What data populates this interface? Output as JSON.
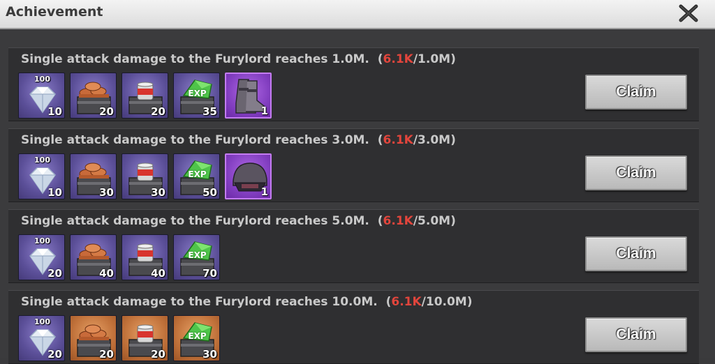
{
  "header": {
    "title": "Achievement",
    "close_icon": "close-icon"
  },
  "colors": {
    "progress_current": "#e2453c",
    "header_bg": "#e8e8e8",
    "row_bg": "#2f2f31"
  },
  "rows": [
    {
      "task": "Single attack damage to the Furylord reaches 1.0M.",
      "progress_open": "(",
      "progress_current": "6.1K",
      "progress_total": "/1.0M)",
      "claim_label": "Claim",
      "rewards": [
        {
          "icon": "diamond-icon",
          "badge": "100",
          "qty": "10",
          "frame": "purple"
        },
        {
          "icon": "wood-chest-icon",
          "qty": "20",
          "frame": "purple"
        },
        {
          "icon": "food-chest-icon",
          "qty": "20",
          "frame": "purple"
        },
        {
          "icon": "exp-chest-icon",
          "badge": "EXP",
          "qty": "35",
          "frame": "purple"
        },
        {
          "icon": "boots-icon",
          "qty": "1",
          "frame": "epic"
        }
      ]
    },
    {
      "task": "Single attack damage to the Furylord reaches 3.0M.",
      "progress_open": "(",
      "progress_current": "6.1K",
      "progress_total": "/3.0M)",
      "claim_label": "Claim",
      "rewards": [
        {
          "icon": "diamond-icon",
          "badge": "100",
          "qty": "10",
          "frame": "purple"
        },
        {
          "icon": "wood-chest-icon",
          "qty": "30",
          "frame": "purple"
        },
        {
          "icon": "food-chest-icon",
          "qty": "30",
          "frame": "purple"
        },
        {
          "icon": "exp-chest-icon",
          "badge": "EXP",
          "qty": "50",
          "frame": "purple"
        },
        {
          "icon": "helmet-icon",
          "qty": "1",
          "frame": "epic"
        }
      ]
    },
    {
      "task": "Single attack damage to the Furylord reaches 5.0M.",
      "progress_open": "(",
      "progress_current": "6.1K",
      "progress_total": "/5.0M)",
      "claim_label": "Claim",
      "rewards": [
        {
          "icon": "diamond-icon",
          "badge": "100",
          "qty": "20",
          "frame": "purple"
        },
        {
          "icon": "wood-chest-icon",
          "qty": "40",
          "frame": "purple"
        },
        {
          "icon": "food-chest-icon",
          "qty": "40",
          "frame": "purple"
        },
        {
          "icon": "exp-chest-icon",
          "badge": "EXP",
          "qty": "70",
          "frame": "purple"
        }
      ]
    },
    {
      "task": "Single attack damage to the Furylord reaches 10.0M.",
      "progress_open": "(",
      "progress_current": "6.1K",
      "progress_total": "/10.0M)",
      "claim_label": "Claim",
      "rewards": [
        {
          "icon": "diamond-icon",
          "badge": "100",
          "qty": "20",
          "frame": "purple"
        },
        {
          "icon": "wood-chest-icon",
          "qty": "20",
          "frame": "orange"
        },
        {
          "icon": "food-chest-icon",
          "qty": "20",
          "frame": "orange"
        },
        {
          "icon": "exp-chest-icon",
          "badge": "EXP",
          "qty": "30",
          "frame": "orange"
        }
      ]
    }
  ]
}
